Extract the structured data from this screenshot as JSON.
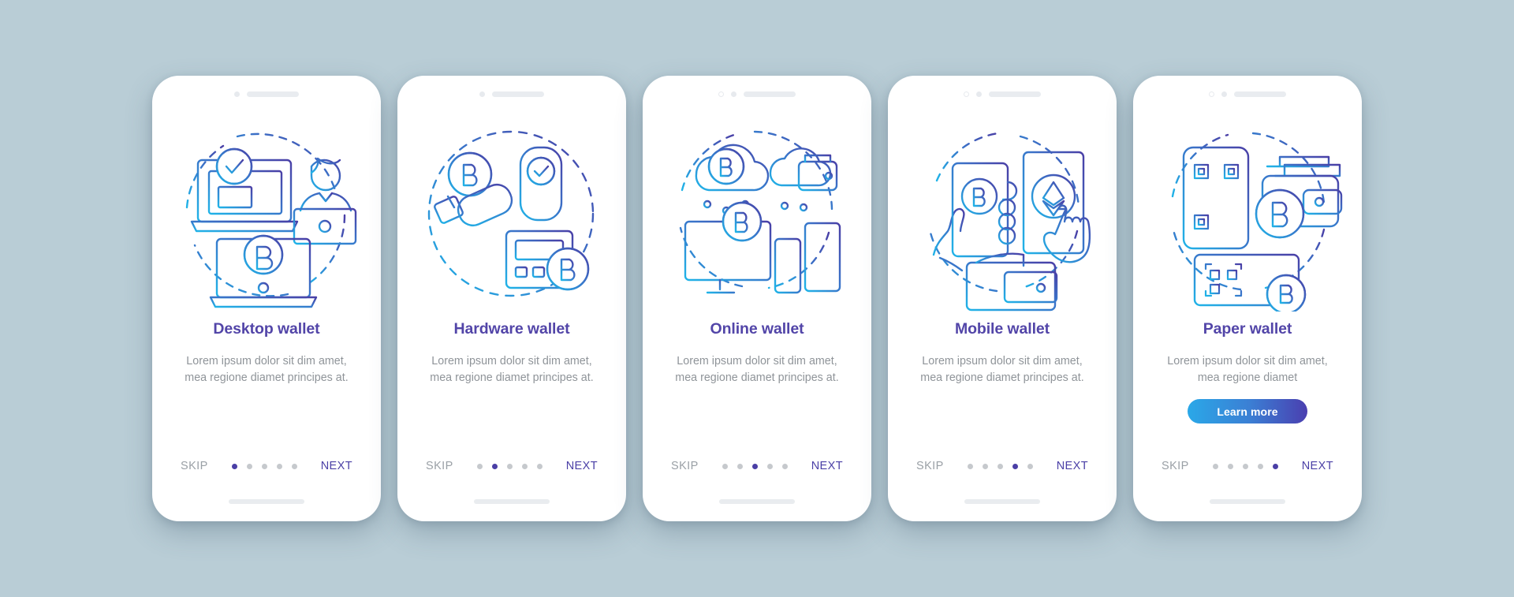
{
  "theme": {
    "background": "#b9cdd6",
    "card_background": "#ffffff",
    "title_color": "#5245a8",
    "body_color": "#8f9499",
    "accent_purple": "#4a3fa6",
    "accent_cyan": "#2aa8e8",
    "dot_inactive": "#c6c9cd",
    "illustration_gradient_start": "#29abe2",
    "illustration_gradient_end": "#4a3fa6"
  },
  "nav_labels": {
    "skip": "SKIP",
    "next": "NEXT"
  },
  "total_steps": 5,
  "screens": [
    {
      "title": "Desktop wallet",
      "body": "Lorem ipsum dolor sit dim amet, mea regione diamet principes at.",
      "active_dot": 1,
      "has_learn_more": false,
      "learn_more_label": "",
      "illustration": "desktop-wallet-illustration",
      "camera_style": "single-dot"
    },
    {
      "title": "Hardware wallet",
      "body": "Lorem ipsum dolor sit dim amet, mea regione diamet principes at.",
      "active_dot": 2,
      "has_learn_more": false,
      "learn_more_label": "",
      "illustration": "hardware-wallet-illustration",
      "camera_style": "single-dot"
    },
    {
      "title": "Online wallet",
      "body": "Lorem ipsum dolor sit dim amet, mea regione diamet principes at.",
      "active_dot": 3,
      "has_learn_more": false,
      "learn_more_label": "",
      "illustration": "online-wallet-illustration",
      "camera_style": "dot-ring"
    },
    {
      "title": "Mobile wallet",
      "body": "Lorem ipsum dolor sit dim amet, mea regione diamet principes at.",
      "active_dot": 4,
      "has_learn_more": false,
      "learn_more_label": "",
      "illustration": "mobile-wallet-illustration",
      "camera_style": "dot-ring"
    },
    {
      "title": "Paper wallet",
      "body": "Lorem ipsum dolor sit dim amet, mea regione diamet",
      "active_dot": 5,
      "has_learn_more": true,
      "learn_more_label": "Learn more",
      "illustration": "paper-wallet-illustration",
      "camera_style": "dot-ring"
    }
  ]
}
